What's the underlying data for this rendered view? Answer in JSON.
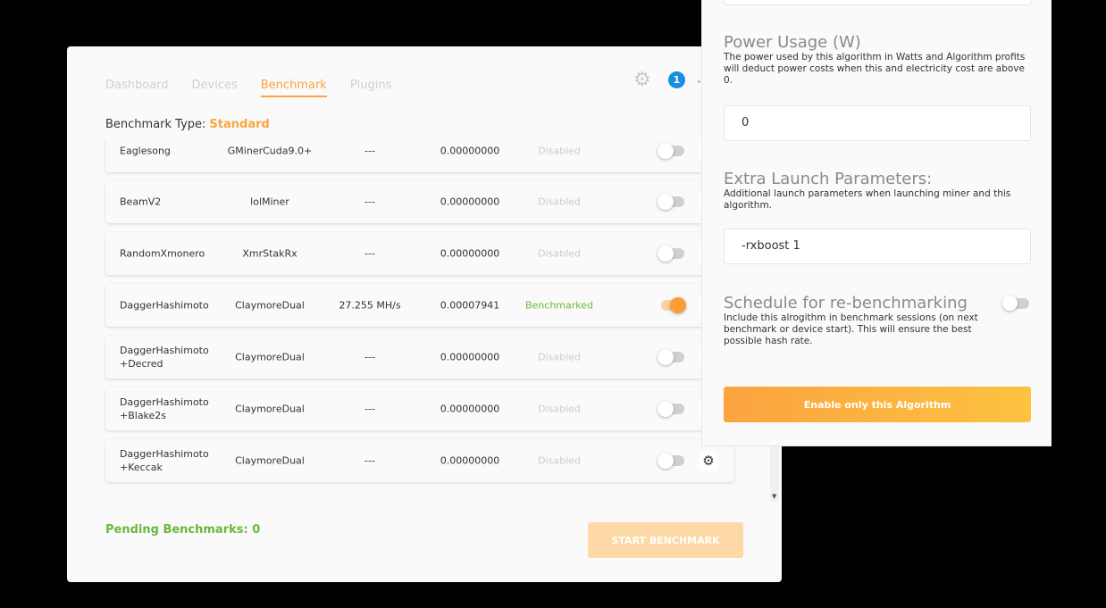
{
  "nav": {
    "tabs": [
      {
        "label": "Dashboard"
      },
      {
        "label": "Devices"
      },
      {
        "label": "Benchmark",
        "active": true
      },
      {
        "label": "Plugins"
      }
    ],
    "notification_count": "1"
  },
  "benchmark_type": {
    "label": "Benchmark Type:",
    "value": "Standard"
  },
  "rows": [
    {
      "algorithm": "Eaglesong",
      "miner": "GMinerCuda9.0+",
      "speed": "---",
      "profit": "0.00000000",
      "status": "Disabled",
      "enabled": false
    },
    {
      "algorithm": "BeamV2",
      "miner": "lolMiner",
      "speed": "---",
      "profit": "0.00000000",
      "status": "Disabled",
      "enabled": false
    },
    {
      "algorithm": "RandomXmonero",
      "miner": "XmrStakRx",
      "speed": "---",
      "profit": "0.00000000",
      "status": "Disabled",
      "enabled": false
    },
    {
      "algorithm": "DaggerHashimoto",
      "miner": "ClaymoreDual",
      "speed": "27.255 MH/s",
      "profit": "0.00007941",
      "status": "Benchmarked",
      "enabled": true
    },
    {
      "algorithm": "DaggerHashimoto\n+Decred",
      "miner": "ClaymoreDual",
      "speed": "---",
      "profit": "0.00000000",
      "status": "Disabled",
      "enabled": false
    },
    {
      "algorithm": "DaggerHashimoto\n+Blake2s",
      "miner": "ClaymoreDual",
      "speed": "---",
      "profit": "0.00000000",
      "status": "Disabled",
      "enabled": false
    },
    {
      "algorithm": "DaggerHashimoto\n+Keccak",
      "miner": "ClaymoreDual",
      "speed": "---",
      "profit": "0.00000000",
      "status": "Disabled",
      "enabled": false
    }
  ],
  "footer": {
    "pending": "Pending Benchmarks: 0",
    "start_button": "START BENCHMARK"
  },
  "panel": {
    "power": {
      "title": "Power Usage (W)",
      "desc": "The power used by this algorithm in Watts and Algorithm profits will deduct power costs when this and electricity cost are above 0.",
      "value": "0"
    },
    "extra": {
      "title": "Extra Launch Parameters:",
      "desc": "Additional launch parameters when launching miner and this algorithm.",
      "value": "-rxboost 1"
    },
    "schedule": {
      "title": "Schedule for re-benchmarking",
      "desc": "Include this alrogithm in benchmark sessions (on next benchmark or device start). This will ensure the best possible hash rate.",
      "enabled": false
    },
    "enable_button": "Enable only this Algorithm"
  },
  "colors": {
    "accent": "#fba440",
    "success": "#6ab93a",
    "badge": "#1a8fe0"
  }
}
